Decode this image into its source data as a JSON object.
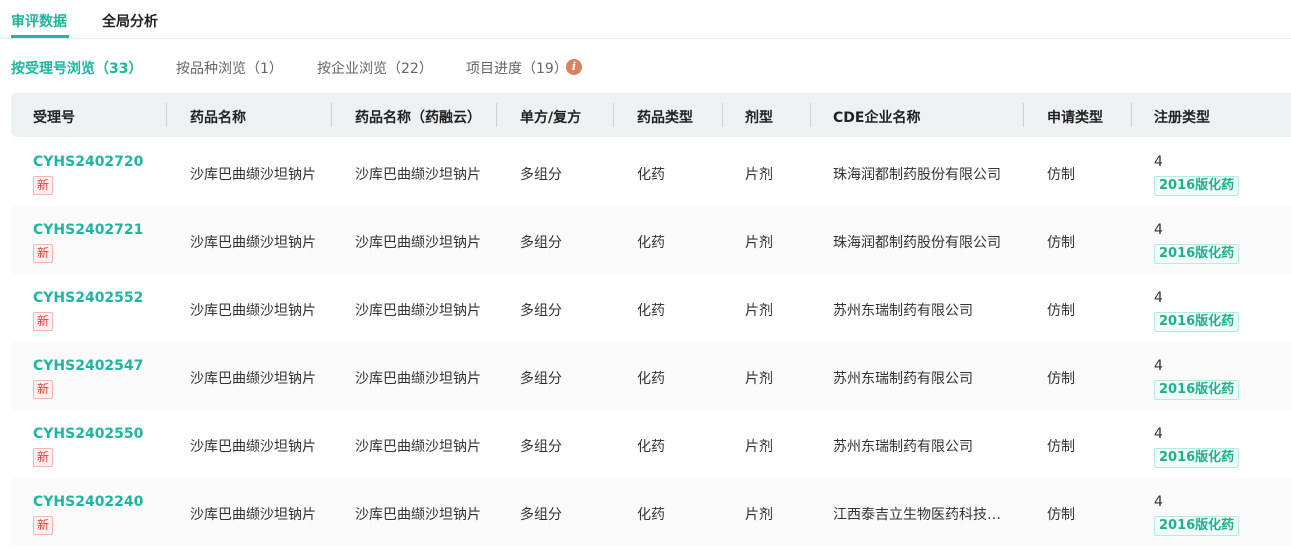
{
  "top_tabs": [
    "审评数据",
    "全局分析"
  ],
  "sub_tabs": [
    "按受理号浏览（33）",
    "按品种浏览（1）",
    "按企业浏览（22）",
    "项目进度（19）"
  ],
  "info_icon": "i",
  "columns": [
    "受理号",
    "药品名称",
    "药品名称（药融云）",
    "单方/复方",
    "药品类型",
    "剂型",
    "CDE企业名称",
    "申请类型",
    "注册类型"
  ],
  "rows": [
    {
      "code": "CYHS2402720",
      "badge": "新",
      "name": "沙库巴曲缬沙坦钠片",
      "name2": "沙库巴曲缬沙坦钠片",
      "compound": "多组分",
      "type": "化药",
      "form": "片剂",
      "company": "珠海润都制药股份有限公司",
      "apply": "仿制",
      "reg": "4",
      "reg_tag": "2016版化药"
    },
    {
      "code": "CYHS2402721",
      "badge": "新",
      "name": "沙库巴曲缬沙坦钠片",
      "name2": "沙库巴曲缬沙坦钠片",
      "compound": "多组分",
      "type": "化药",
      "form": "片剂",
      "company": "珠海润都制药股份有限公司",
      "apply": "仿制",
      "reg": "4",
      "reg_tag": "2016版化药"
    },
    {
      "code": "CYHS2402552",
      "badge": "新",
      "name": "沙库巴曲缬沙坦钠片",
      "name2": "沙库巴曲缬沙坦钠片",
      "compound": "多组分",
      "type": "化药",
      "form": "片剂",
      "company": "苏州东瑞制药有限公司",
      "apply": "仿制",
      "reg": "4",
      "reg_tag": "2016版化药"
    },
    {
      "code": "CYHS2402547",
      "badge": "新",
      "name": "沙库巴曲缬沙坦钠片",
      "name2": "沙库巴曲缬沙坦钠片",
      "compound": "多组分",
      "type": "化药",
      "form": "片剂",
      "company": "苏州东瑞制药有限公司",
      "apply": "仿制",
      "reg": "4",
      "reg_tag": "2016版化药"
    },
    {
      "code": "CYHS2402550",
      "badge": "新",
      "name": "沙库巴曲缬沙坦钠片",
      "name2": "沙库巴曲缬沙坦钠片",
      "compound": "多组分",
      "type": "化药",
      "form": "片剂",
      "company": "苏州东瑞制药有限公司",
      "apply": "仿制",
      "reg": "4",
      "reg_tag": "2016版化药"
    },
    {
      "code": "CYHS2402240",
      "badge": "新",
      "name": "沙库巴曲缬沙坦钠片",
      "name2": "沙库巴曲缬沙坦钠片",
      "compound": "多组分",
      "type": "化药",
      "form": "片剂",
      "company": "江西泰吉立生物医药科技…",
      "apply": "仿制",
      "reg": "4",
      "reg_tag": "2016版化药"
    }
  ]
}
